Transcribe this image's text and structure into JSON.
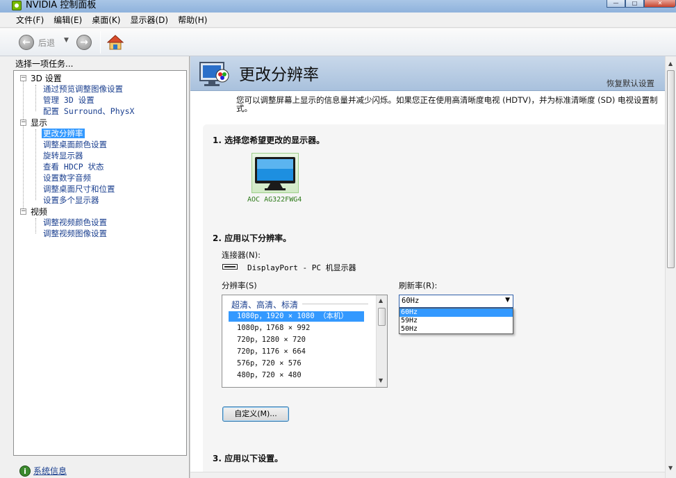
{
  "window": {
    "title": "NVIDIA 控制面板",
    "controls": {
      "minimize": "—",
      "maximize": "□",
      "close": "✕"
    }
  },
  "menu": [
    "文件(F)",
    "编辑(E)",
    "桌面(K)",
    "显示器(D)",
    "帮助(H)"
  ],
  "toolbar": {
    "back_label": "后退"
  },
  "left": {
    "title": "选择一项任务...",
    "tree": [
      {
        "label": "3D 设置",
        "children": [
          "通过预览调整图像设置",
          "管理 3D 设置",
          "配置 Surround、PhysX"
        ]
      },
      {
        "label": "显示",
        "children": [
          "更改分辨率",
          "调整桌面颜色设置",
          "旋转显示器",
          "查看 HDCP 状态",
          "设置数字音频",
          "调整桌面尺寸和位置",
          "设置多个显示器"
        ]
      },
      {
        "label": "视频",
        "children": [
          "调整视频颜色设置",
          "调整视频图像设置"
        ]
      }
    ],
    "selected": "更改分辨率",
    "system_info": "系统信息"
  },
  "page": {
    "title": "更改分辨率",
    "restore": "恢复默认设置",
    "description": "您可以调整屏幕上显示的信息量并减少闪烁。如果您正在使用高清晰度电视 (HDTV)，并为标准清晰度 (SD) 电视设置制式。",
    "step1": "1.  选择您希望更改的显示器。",
    "monitor_name": "AOC AG322FWG4",
    "step2": "2.  应用以下分辨率。",
    "connector_label": "连接器(N):",
    "connector_value": "DisplayPort - PC 机显示器",
    "resolution_label": "分辨率(S)",
    "refresh_label": "刷新率(R):",
    "resolution_group": "超清、高清、标清",
    "resolutions": [
      "1080p，1920 × 1080 （本机）",
      "1080p，1768 × 992",
      "720p，1280 × 720",
      "720p，1176 × 664",
      "576p，720 × 576",
      "480p，720 × 480"
    ],
    "refresh_selected": "60Hz",
    "refresh_options": [
      "60Hz",
      "59Hz",
      "50Hz"
    ],
    "custom_button": "自定义(M)...",
    "step3": "3.  应用以下设置。"
  },
  "colors": {
    "nvidia_green": "#76b900",
    "selection_blue": "#3399ff",
    "link_blue": "#1a3f8f"
  }
}
